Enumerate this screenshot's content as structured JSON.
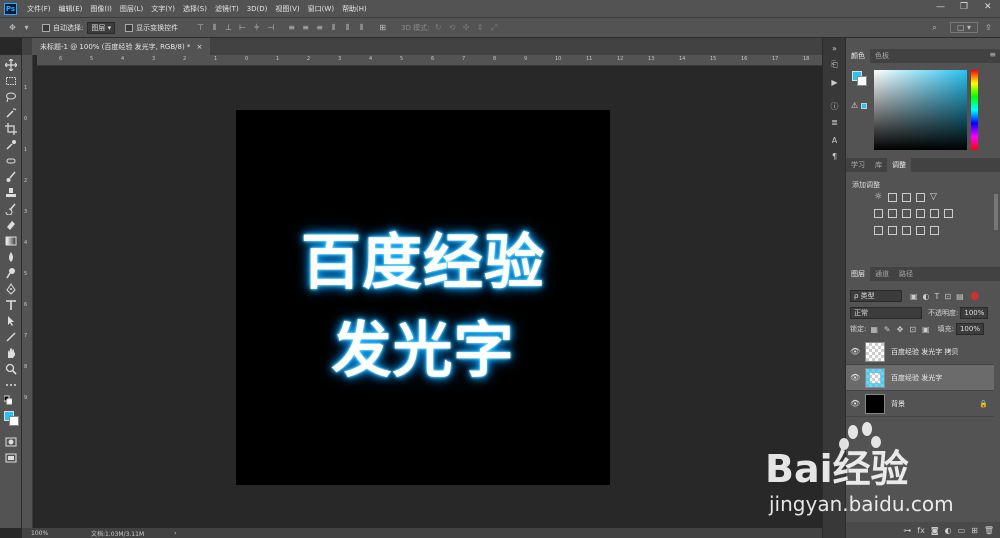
{
  "app": {
    "logo": "Ps"
  },
  "menu": [
    "文件(F)",
    "编辑(E)",
    "图像(I)",
    "图层(L)",
    "文字(Y)",
    "选择(S)",
    "滤镜(T)",
    "3D(D)",
    "视图(V)",
    "窗口(W)",
    "帮助(H)"
  ],
  "window_controls": {
    "minimize": "—",
    "maximize": "❐",
    "close": "✕"
  },
  "options": {
    "auto_select_label": "自动选择:",
    "auto_select_value": "图层",
    "show_transform_label": "显示变换控件",
    "mode_3d_label": "3D 模式:"
  },
  "document": {
    "tab_title": "未标题-1 @ 100% (百度经验 发光字, RGB/8) *",
    "close": "×",
    "canvas_line1": "百度经验",
    "canvas_line2": "发光字"
  },
  "rulers": {
    "top": [
      "6",
      "5",
      "4",
      "3",
      "2",
      "1",
      "0",
      "1",
      "2",
      "3",
      "4",
      "5",
      "6",
      "7",
      "8",
      "9",
      "10",
      "11",
      "12",
      "13",
      "14",
      "15",
      "16",
      "17",
      "18"
    ],
    "left": [
      "1",
      "0",
      "1",
      "2",
      "3",
      "4",
      "5",
      "6",
      "7",
      "8",
      "9"
    ]
  },
  "status": {
    "zoom": "100%",
    "doc_info": "文档:1.03M/3.11M",
    "arrow": "›"
  },
  "color_panel": {
    "tabs": [
      "颜色",
      "色板"
    ],
    "fg_color": "#28c3f2",
    "bg_color": "#ffffff"
  },
  "adjust_panel": {
    "tabs": [
      "学习",
      "库",
      "调整"
    ],
    "title": "添加调整"
  },
  "layers_panel": {
    "tabs": [
      "图层",
      "通道",
      "路径"
    ],
    "filter": "ρ 类型",
    "blend_mode": "正常",
    "opacity_label": "不透明度:",
    "opacity_value": "100%",
    "lock_label": "锁定:",
    "fill_label": "填充:",
    "fill_value": "100%",
    "layers": [
      {
        "name": "百度经验 发光字 拷贝",
        "thumb": "checker",
        "active": false
      },
      {
        "name": "百度经验 发光字",
        "thumb": "glow",
        "active": true
      },
      {
        "name": "背景",
        "thumb": "dark",
        "active": false
      }
    ],
    "lock_icon": "🔒",
    "eye_icon": "👁"
  },
  "watermark": {
    "brand": "Bai经验",
    "url": "jingyan.baidu.com"
  }
}
